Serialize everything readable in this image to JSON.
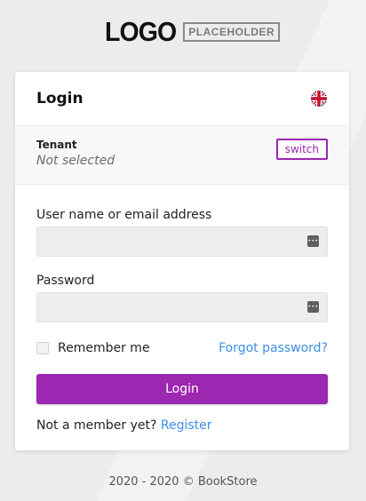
{
  "logo": {
    "word": "LOGO",
    "tag": "PLACEHOLDER"
  },
  "card": {
    "title": "Login",
    "language_icon": "uk-flag-icon"
  },
  "tenant": {
    "label": "Tenant",
    "value": "Not selected",
    "switch_label": "switch"
  },
  "form": {
    "username_label": "User name or email address",
    "username_value": "",
    "password_label": "Password",
    "password_value": "",
    "field_icon": "password-manager-icon",
    "remember_label": "Remember me",
    "forgot_label": "Forgot password?",
    "submit_label": "Login",
    "register_prompt": "Not a member yet?",
    "register_link": "Register"
  },
  "footer": {
    "text": "2020 - 2020 © BookStore"
  },
  "colors": {
    "accent": "#9c27b0",
    "link": "#3d8ee6",
    "background": "#ececec"
  }
}
